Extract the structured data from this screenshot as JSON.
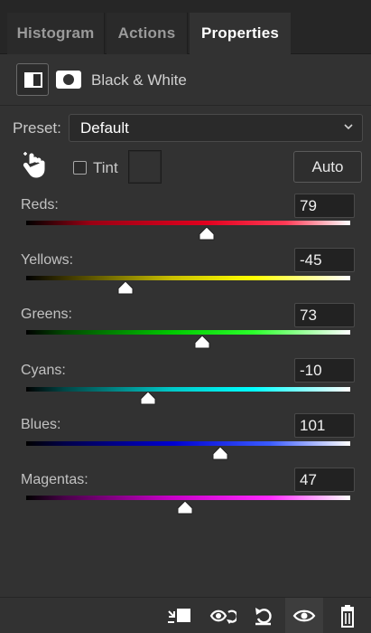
{
  "tabs": [
    {
      "label": "Histogram"
    },
    {
      "label": "Actions"
    },
    {
      "label": "Properties",
      "active": true
    }
  ],
  "header": {
    "adjustment_title": "Black & White",
    "adjustment_icon": "black-white-adjustment-icon",
    "mask_icon": "layer-mask-icon"
  },
  "preset": {
    "label": "Preset:",
    "value": "Default"
  },
  "tint": {
    "label": "Tint",
    "checked": false,
    "color": "#323232"
  },
  "auto_button": "Auto",
  "sliders": [
    {
      "label": "Reds:",
      "value": "79",
      "range": [
        -200,
        300
      ]
    },
    {
      "label": "Yellows:",
      "value": "-45",
      "range": [
        -200,
        300
      ]
    },
    {
      "label": "Greens:",
      "value": "73",
      "range": [
        -200,
        300
      ]
    },
    {
      "label": "Cyans:",
      "value": "-10",
      "range": [
        -200,
        300
      ]
    },
    {
      "label": "Blues:",
      "value": "101",
      "range": [
        -200,
        300
      ]
    },
    {
      "label": "Magentas:",
      "value": "47",
      "range": [
        -200,
        300
      ]
    }
  ],
  "footer_icons": [
    "clip-to-layer-icon",
    "view-previous-state-icon",
    "reset-icon",
    "toggle-visibility-icon",
    "delete-icon"
  ]
}
